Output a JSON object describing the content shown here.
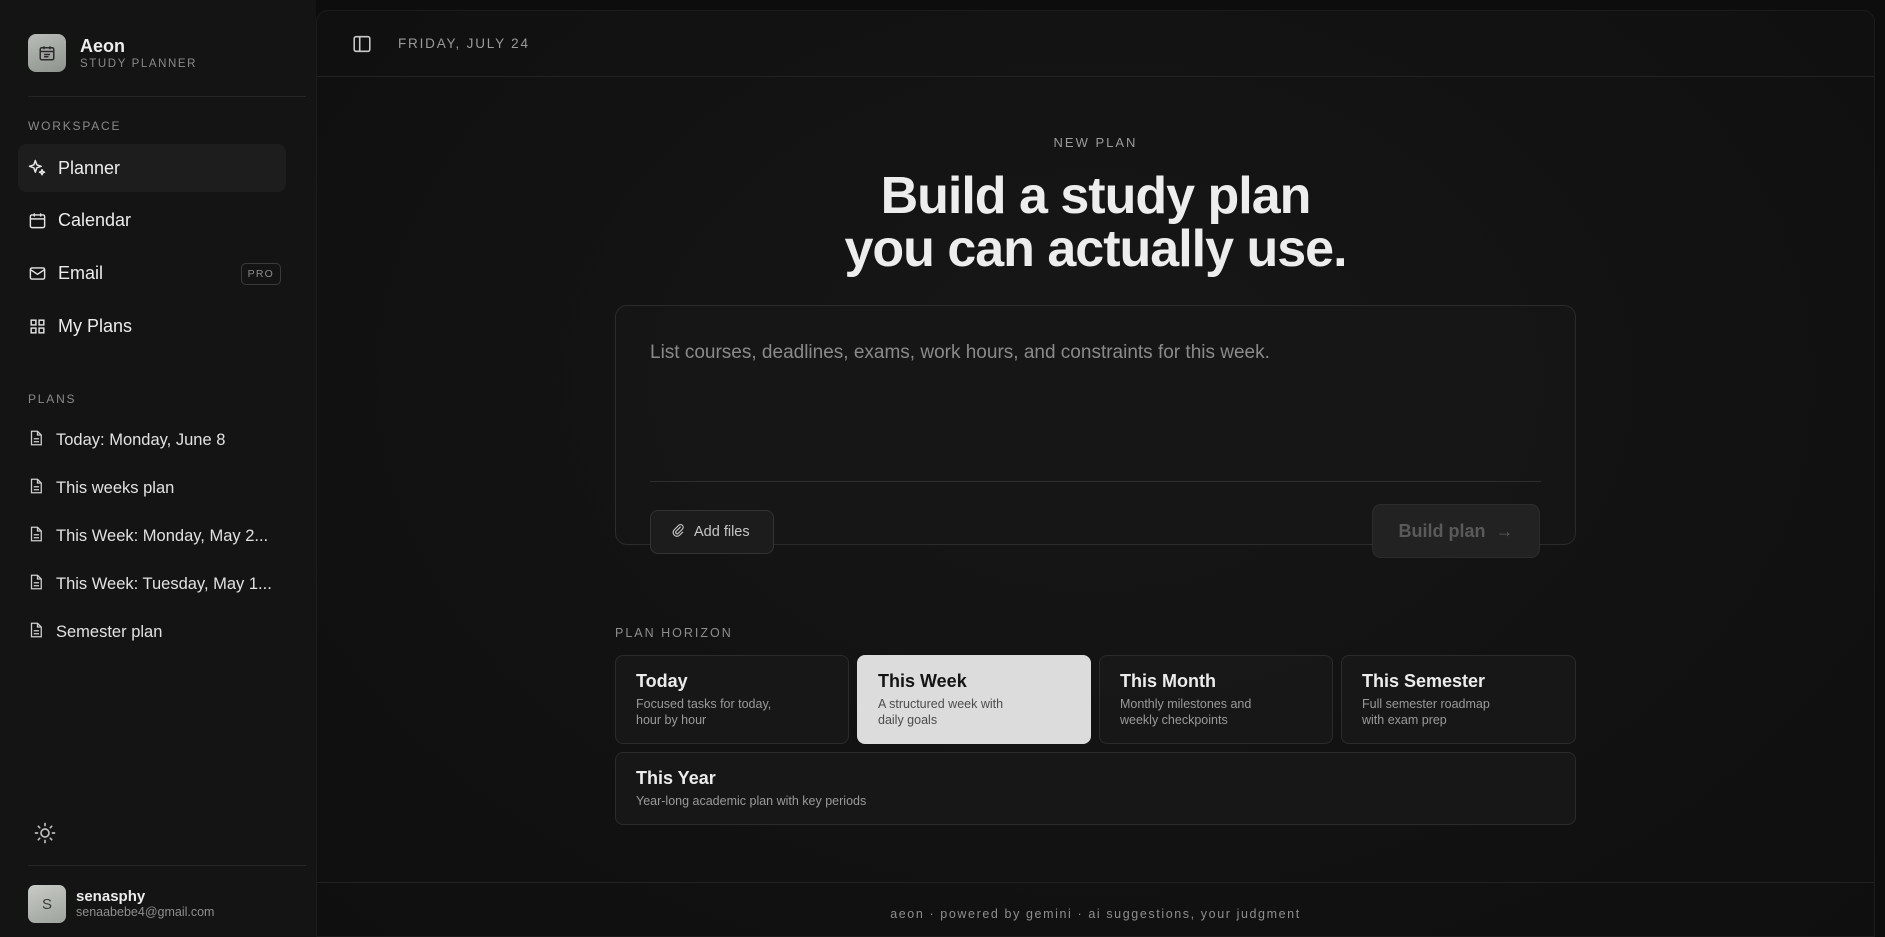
{
  "brand": {
    "name": "Aeon",
    "subtitle": "STUDY PLANNER",
    "logo_icon": "calendar-icon"
  },
  "sidebar": {
    "workspace_label": "WORKSPACE",
    "nav": [
      {
        "label": "Planner",
        "icon": "sparkles-icon",
        "active": true
      },
      {
        "label": "Calendar",
        "icon": "calendar-icon"
      },
      {
        "label": "Email",
        "icon": "mail-icon",
        "badge": "PRO"
      },
      {
        "label": "My Plans",
        "icon": "grid-icon"
      }
    ],
    "plans_label": "PLANS",
    "plans": [
      {
        "label": "Today: Monday, June 8"
      },
      {
        "label": "This weeks plan"
      },
      {
        "label": "This Week: Monday, May 2..."
      },
      {
        "label": "This Week: Tuesday, May 1..."
      },
      {
        "label": "Semester plan"
      }
    ]
  },
  "user": {
    "initial": "S",
    "name": "senasphy",
    "email": "senaabebe4@gmail.com"
  },
  "topbar": {
    "date": "FRIDAY, JULY 24"
  },
  "main": {
    "eyebrow": "NEW PLAN",
    "headline_line1": "Build a study plan",
    "headline_line2": "you can actually use.",
    "prompt_placeholder": "List courses, deadlines, exams, work hours, and constraints for this week.",
    "prompt_value": "",
    "add_files_label": "Add files",
    "build_label": "Build plan",
    "build_arrow": "→",
    "horizon_label": "PLAN HORIZON",
    "horizons": [
      {
        "title": "Today",
        "desc": "Focused tasks for today, hour by hour",
        "selected": false
      },
      {
        "title": "This Week",
        "desc": "A structured week with daily goals",
        "selected": true
      },
      {
        "title": "This Month",
        "desc": "Monthly milestones and weekly checkpoints",
        "selected": false
      },
      {
        "title": "This Semester",
        "desc": "Full semester roadmap with exam prep",
        "selected": false
      },
      {
        "title": "This Year",
        "desc": "Year-long academic plan with key periods",
        "selected": false
      }
    ]
  },
  "footer": {
    "text": "aeon · powered by gemini · ai suggestions, your judgment"
  },
  "colors": {
    "background": "#0d0d0d",
    "sidebar": "#141414",
    "selected_card": "#dcdcdc",
    "text": "#ededed"
  }
}
